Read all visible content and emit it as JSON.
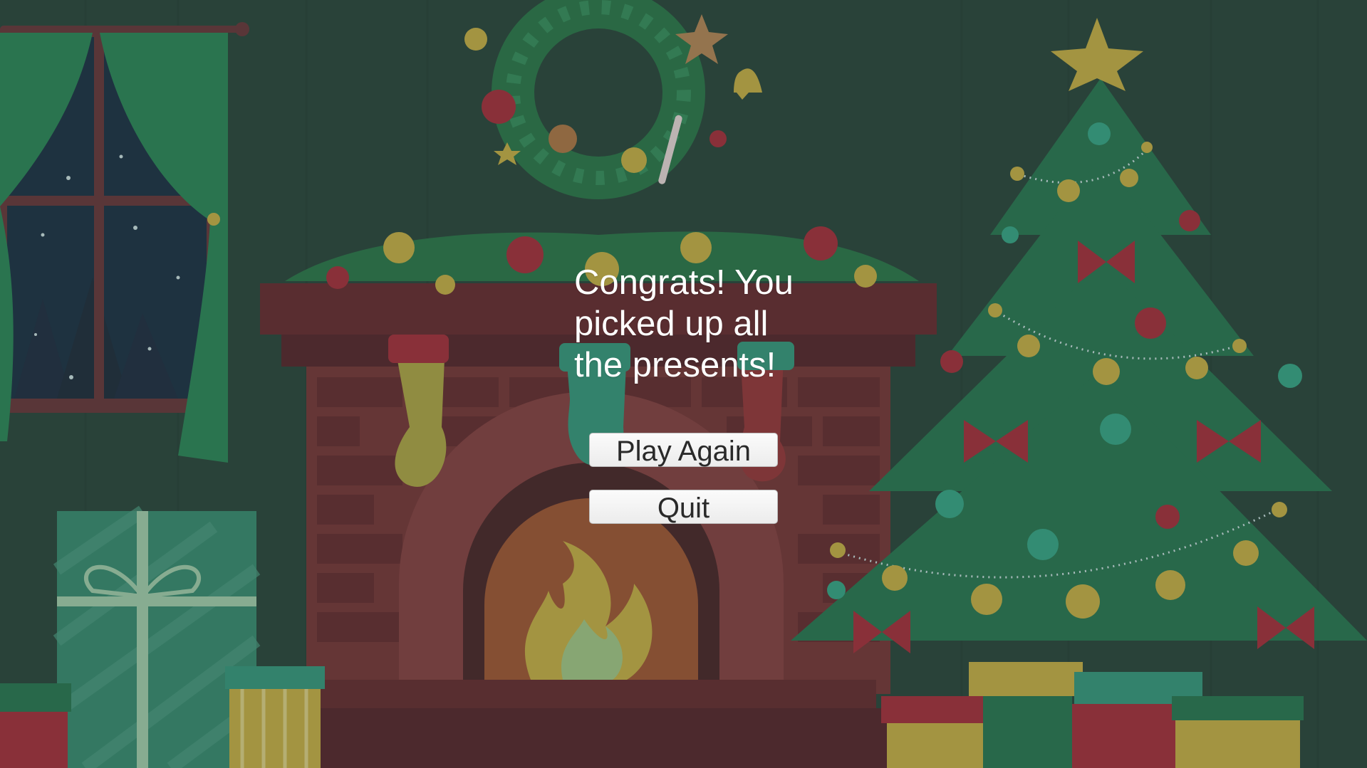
{
  "screen": {
    "message": "Congrats! You picked up all the presents!",
    "play_again_label": "Play Again",
    "quit_label": "Quit"
  },
  "colors": {
    "wall": "#2e4a3f",
    "brick": "#7a3a3c",
    "garland": "#2f7a4e",
    "tree": "#2c7a55",
    "gold": "#c9b24a",
    "red_ornament": "#a8333f",
    "button_bg": "#f4f4f4",
    "text": "#ffffff"
  },
  "icons": [
    "wreath-icon",
    "stocking-icon",
    "christmas-tree-icon",
    "star-icon",
    "gift-box-icon",
    "fire-icon",
    "window-icon"
  ]
}
